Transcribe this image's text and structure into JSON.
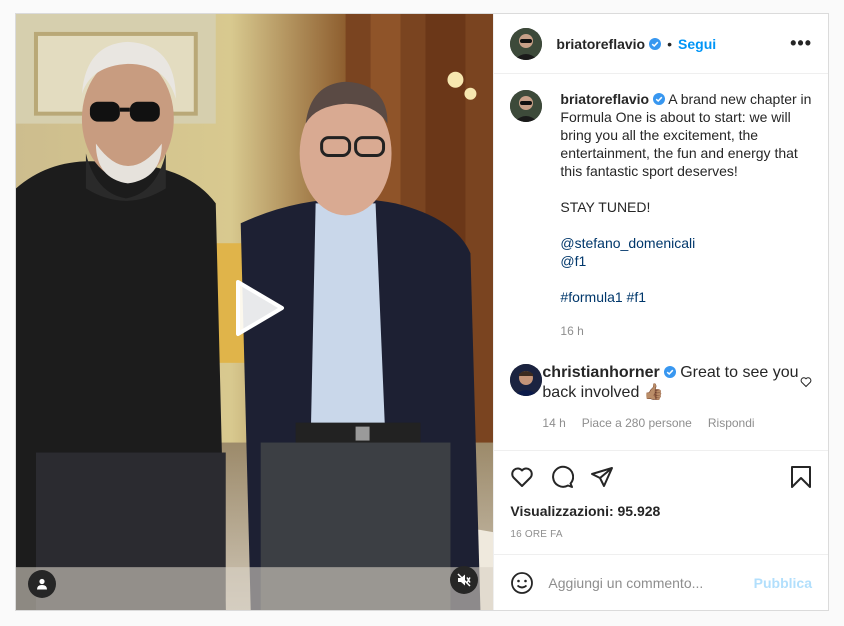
{
  "post": {
    "author": "briatoreflavio",
    "dot": "•",
    "follow_label": "Segui",
    "more_label": "•••",
    "caption_lines": [
      "A brand new chapter in",
      "Formula One is about to start: we will",
      "bring you all the excitement, the",
      "entertainment, the fun and energy that",
      "this fantastic sport deserves!",
      "",
      "STAY TUNED!",
      "",
      "@stefano_domenicali",
      "@f1",
      "",
      "#formula1 #f1"
    ],
    "caption_time": "16 h"
  },
  "comment": {
    "author": "christianhorner",
    "text_line1": "Great to see you",
    "text_line2": "back involved 👍🏽",
    "time": "14 h",
    "likes": "Piace a 280 persone",
    "reply": "Rispondi"
  },
  "actions": {
    "views_label": "Visualizzazioni:",
    "views_count": "95.928",
    "posted_ago": "16 ORE FA"
  },
  "add_comment": {
    "placeholder": "Aggiungi un commento...",
    "publish_label": "Pubblica"
  },
  "colors": {
    "accent": "#0095f6",
    "publish_disabled": "#b2dffc",
    "verified": "#3897f0"
  },
  "icons": [
    "play-icon",
    "user-tag-icon",
    "mute-icon",
    "verified-icon",
    "heart-icon",
    "comment-icon",
    "share-icon",
    "bookmark-icon",
    "emoji-icon"
  ]
}
